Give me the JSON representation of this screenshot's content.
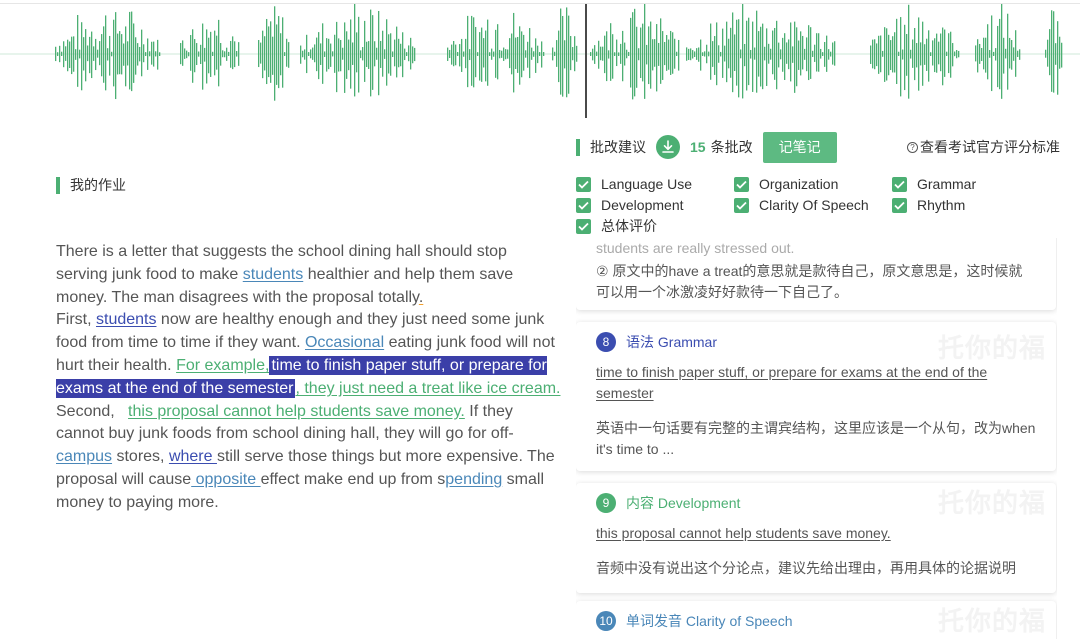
{
  "homework": {
    "title": "我的作业"
  },
  "essay": {
    "p1": {
      "t1": "There is a letter that suggests the school dining hall should stop serving junk food to make ",
      "l1": "students",
      "t2": " healthier and help them save money. The man disagrees with the proposal totally",
      "l2": "."
    },
    "p2": {
      "t1": "First, ",
      "l1": "students",
      "t2": " now are healthy enough and they just need some junk food from time to time if they want. ",
      "l2": "Occasional",
      "t3": " eating junk food will not hurt their health. ",
      "l3": "For example,",
      "hl": "time to finish paper stuff, or prepare for exams at the end of the semester",
      "l4": ", they just need a treat like ice cream."
    },
    "p3": {
      "t1": "Second,   ",
      "l1": "this proposal cannot help students save money.",
      "t2": " If they cannot buy junk foods from school dining hall, they will go for off-",
      "l2": "campus",
      "t3": " stores, ",
      "l3": "where ",
      "t4": "still serve those things but more expensive. The proposal will cause",
      "l4": " opposite ",
      "t5": "effect make end up from s",
      "l5": "pending",
      "t6": " small money to paying more."
    }
  },
  "review": {
    "title": "批改建议",
    "count": "15",
    "count_label": "条批改",
    "note_button": "记笔记",
    "standard_link": "查看考试官方评分标准"
  },
  "filters": [
    {
      "label": "Language Use",
      "checked": true
    },
    {
      "label": "Organization",
      "checked": true
    },
    {
      "label": "Grammar",
      "checked": true
    },
    {
      "label": "Development",
      "checked": true
    },
    {
      "label": "Clarity Of Speech",
      "checked": true
    },
    {
      "label": "Rhythm",
      "checked": true
    },
    {
      "label": "总体评价",
      "checked": true
    }
  ],
  "cards": {
    "c7": {
      "faded": "students are really stressed out.",
      "body": "② 原文中的have a treat的意思就是款待自己，原文意思是，这时候就可以用一个冰激凌好好款待一下自己了。"
    },
    "c8": {
      "num": "8",
      "category": "语法 Grammar",
      "quote": "time to finish paper stuff, or prepare for exams at the end of the semester",
      "body": "英语中一句话要有完整的主谓宾结构，这里应该是一个从句，改为when it's time to ..."
    },
    "c9": {
      "num": "9",
      "category": "内容 Development",
      "quote": "this proposal cannot help students save money.",
      "body": "音频中没有说出这个分论点，建议先给出理由，再用具体的论据说明"
    },
    "c10": {
      "num": "10",
      "category": "单词发音 Clarity of Speech"
    },
    "watermark": "托你的福"
  },
  "colors": {
    "accent": "#4caf73",
    "highlight": "#3b3fa8",
    "grammar": "#3b4db0",
    "pronunciation": "#4a87b8"
  }
}
